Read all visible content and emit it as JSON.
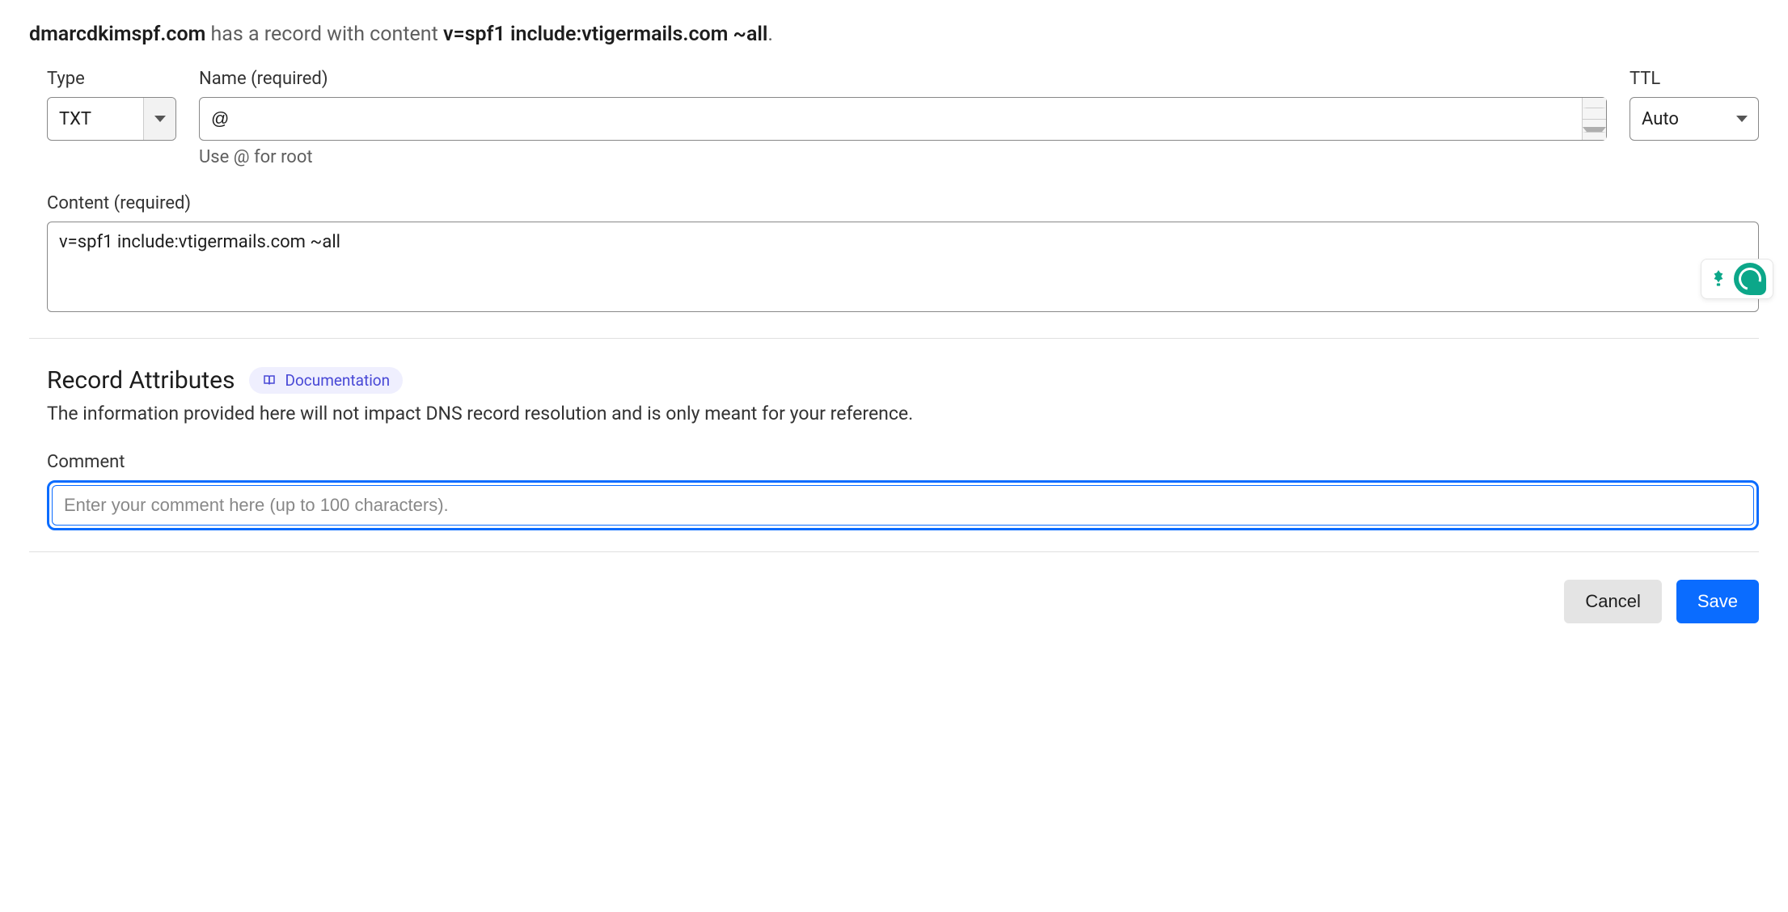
{
  "header": {
    "domain": "dmarcdkimspf.com",
    "mid_text": " has a record with content ",
    "content_value": "v=spf1 include:vtigermails.com ~all",
    "end_punct": "."
  },
  "fields": {
    "type": {
      "label": "Type",
      "value": "TXT"
    },
    "name": {
      "label": "Name (required)",
      "value": "@",
      "hint": "Use @ for root"
    },
    "ttl": {
      "label": "TTL",
      "value": "Auto"
    },
    "content": {
      "label": "Content (required)",
      "value": "v=spf1 include:vtigermails.com ~all"
    }
  },
  "attributes": {
    "title": "Record Attributes",
    "doc_label": "Documentation",
    "description": "The information provided here will not impact DNS record resolution and is only meant for your reference.",
    "comment_label": "Comment",
    "comment_placeholder": "Enter your comment here (up to 100 characters)."
  },
  "actions": {
    "cancel": "Cancel",
    "save": "Save"
  }
}
